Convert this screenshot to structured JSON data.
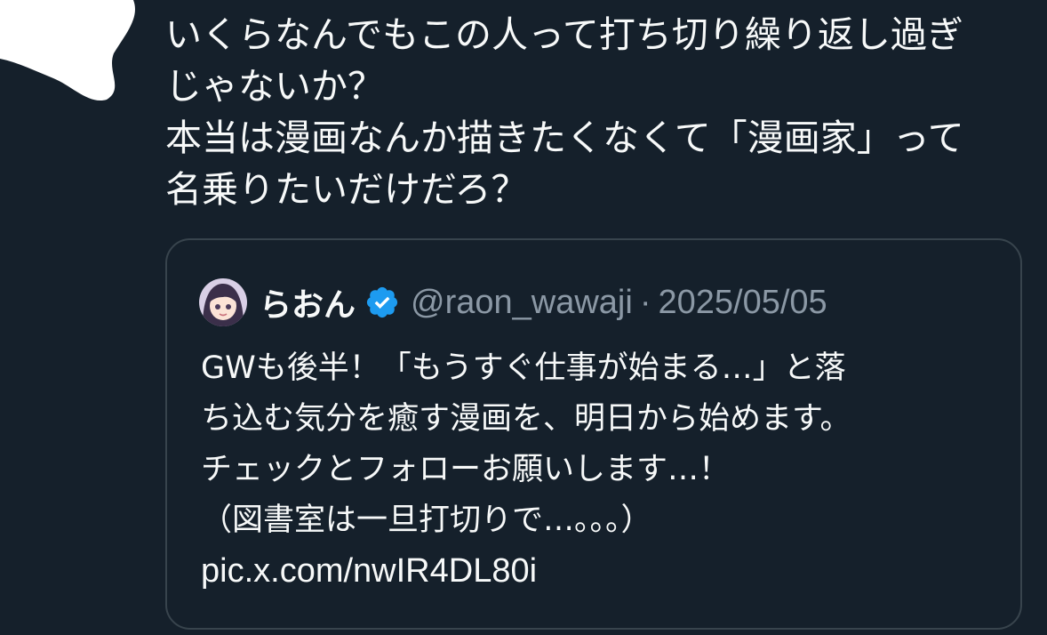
{
  "tweet": {
    "text_lines": [
      "いくらなんでもこの人って打ち切り繰り返し過ぎ",
      "じゃないか？",
      "本当は漫画なんか描きたくなくて「漫画家」って",
      "名乗りたいだけだろ？"
    ]
  },
  "quote": {
    "avatar_icon": "user-avatar-anime-girl",
    "display_name": "らおん",
    "verified_icon": "verified-badge-icon",
    "handle": "@raon_wawaji",
    "separator": "·",
    "date": "2025/05/05",
    "body_lines": [
      "GWも後半！「もうすぐ仕事が始まる…」と落",
      "ち込む気分を癒す漫画を、明日から始めます。",
      "チェックとフォローお願いします…！",
      "（図書室は一旦打切りで…。。。）"
    ],
    "link": "pic.x.com/nwIR4DL80i"
  },
  "colors": {
    "background": "#15202b",
    "text": "#f7f9f9",
    "muted": "#8b98a5",
    "border": "#38444d",
    "verified": "#1d9bf0"
  }
}
